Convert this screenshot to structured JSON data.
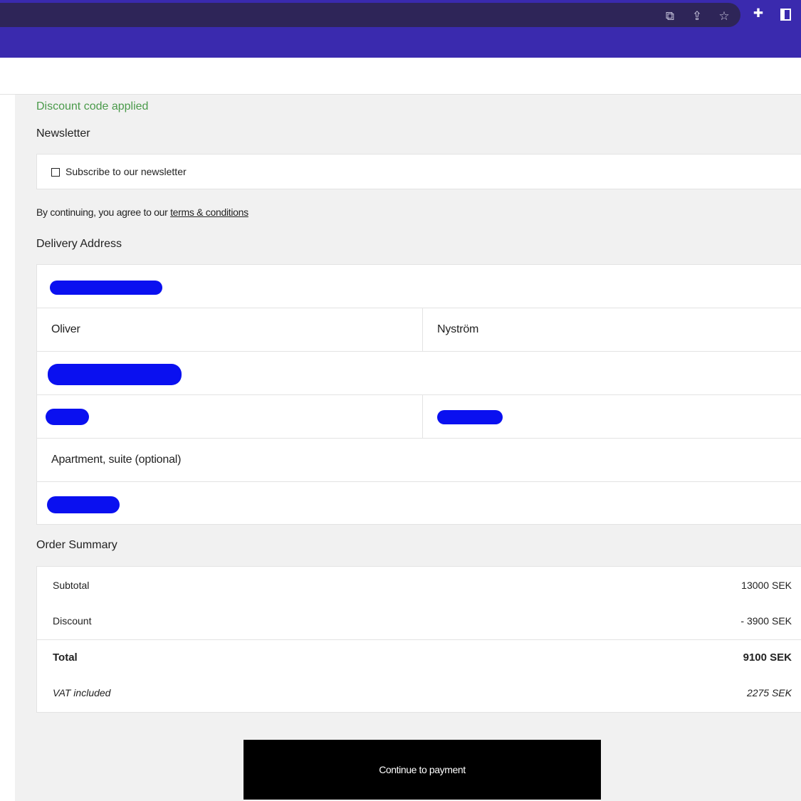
{
  "browser": {
    "icons": [
      "translate-icon",
      "share-icon",
      "star-icon",
      "extensions-icon",
      "side-panel-icon"
    ]
  },
  "checkout": {
    "discount_message": "Discount code applied",
    "newsletter": {
      "title": "Newsletter",
      "checkbox_label": "Subscribe to our newsletter",
      "checked": false
    },
    "terms": {
      "prefix": "By continuing, you agree to our ",
      "link_text": "terms & conditions"
    },
    "delivery": {
      "title": "Delivery Address",
      "first_name": "Oliver",
      "last_name": "Nyström",
      "apartment_placeholder": "Apartment, suite (optional)"
    },
    "summary": {
      "title": "Order Summary",
      "subtotal_label": "Subtotal",
      "subtotal_value": "13000 SEK",
      "discount_label": "Discount",
      "discount_value": "- 3900 SEK",
      "total_label": "Total",
      "total_value": "9100 SEK",
      "vat_label": "VAT included",
      "vat_value": "2275 SEK"
    },
    "continue_button": "Continue to payment"
  },
  "colors": {
    "chrome_purple": "#3a2aae",
    "discount_green": "#4a9a4a",
    "redaction_blue": "#0a10f0",
    "button_black": "#000000"
  }
}
